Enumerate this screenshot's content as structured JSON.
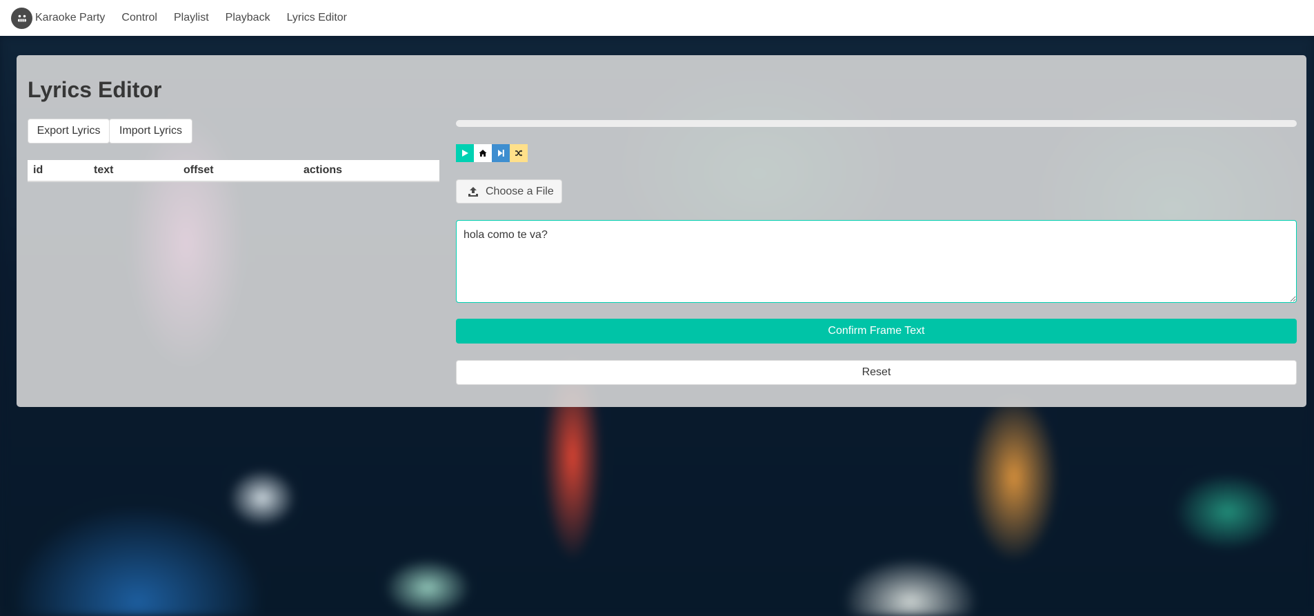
{
  "navbar": {
    "brand": "Karaoke Party",
    "items": [
      "Control",
      "Playlist",
      "Playback",
      "Lyrics Editor"
    ]
  },
  "editor": {
    "title": "Lyrics Editor",
    "export_label": "Export Lyrics",
    "import_label": "Import Lyrics",
    "table": {
      "columns": [
        "id",
        "text",
        "offset",
        "actions"
      ],
      "rows": []
    },
    "progress": 0,
    "transport_icons": [
      "play-icon",
      "home-icon",
      "step-forward-icon",
      "shuffle-icon"
    ],
    "file_label": "Choose a File",
    "frame_text": "hola como te va?",
    "confirm_label": "Confirm Frame Text",
    "reset_label": "Reset"
  },
  "colors": {
    "primary": "#00d1b2",
    "info": "#3e8ed0",
    "warning": "#ffe08a",
    "panel": "#dedede"
  }
}
